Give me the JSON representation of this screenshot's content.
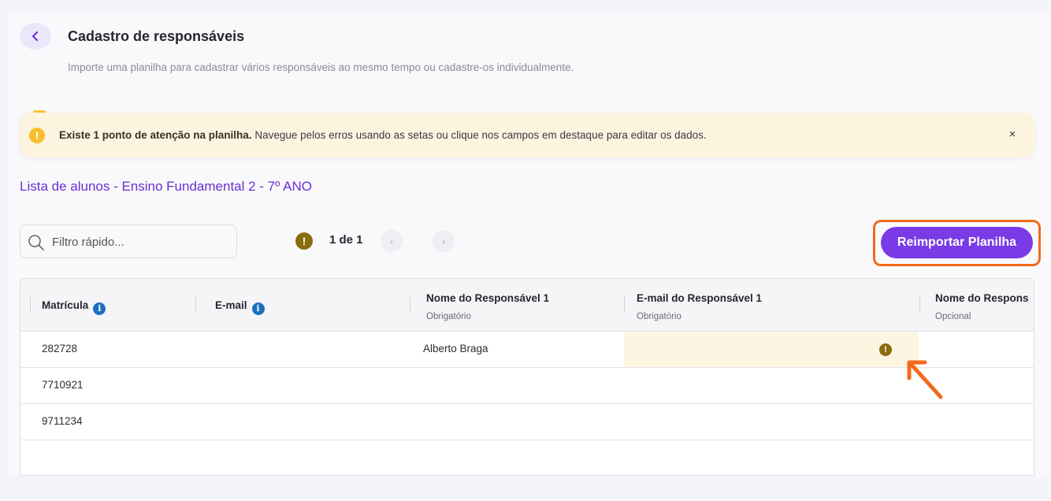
{
  "header": {
    "title": "Cadastro de responsáveis",
    "subtitle": "Importe uma planilha para cadastrar vários responsáveis ao mesmo tempo ou cadastre-os individualmente."
  },
  "alert": {
    "bold_text": "Existe 1 ponto de atenção na planilha.",
    "text": " Navegue pelos erros usando as setas ou clique nos campos em destaque para editar os dados.",
    "close_label": "×",
    "color": "#fdf4e0"
  },
  "list_title": "Lista de alunos - Ensino Fundamental 2 - 7º ANO",
  "search": {
    "placeholder": "Filtro rápido..."
  },
  "pagination": {
    "label": "1 de 1",
    "prev": "‹",
    "next": "›"
  },
  "reimport_button": {
    "label": "Reimportar Planilha",
    "color": "#7a3ae6"
  },
  "table": {
    "columns": [
      {
        "label": "Matrícula",
        "sub": "",
        "info": true
      },
      {
        "label": "E-mail",
        "sub": "",
        "info": true
      },
      {
        "label": "Nome do Responsável 1",
        "sub": "Obrigatório",
        "info": false
      },
      {
        "label": "E-mail do Responsável 1",
        "sub": "Obrigatório",
        "info": false
      },
      {
        "label": "Nome do Respons",
        "sub": "Opcional",
        "info": false
      }
    ],
    "rows": [
      {
        "matricula": "282728",
        "email": "",
        "nome_resp_1": "Alberto Braga",
        "email_resp_1": "",
        "has_error": true
      },
      {
        "matricula": "7710921",
        "email": "",
        "nome_resp_1": "",
        "email_resp_1": ""
      },
      {
        "matricula": "9711234",
        "email": "",
        "nome_resp_1": "",
        "email_resp_1": ""
      }
    ]
  },
  "icons": {
    "back": "chevron-left-icon",
    "alert": "warning-circle-icon",
    "search": "search-icon",
    "info": "info-icon",
    "error": "error-circle-icon",
    "annotation": "arrow-annotation-icon"
  },
  "accent_color": "#6a2fd0",
  "annotation_color": "#f26a1b"
}
